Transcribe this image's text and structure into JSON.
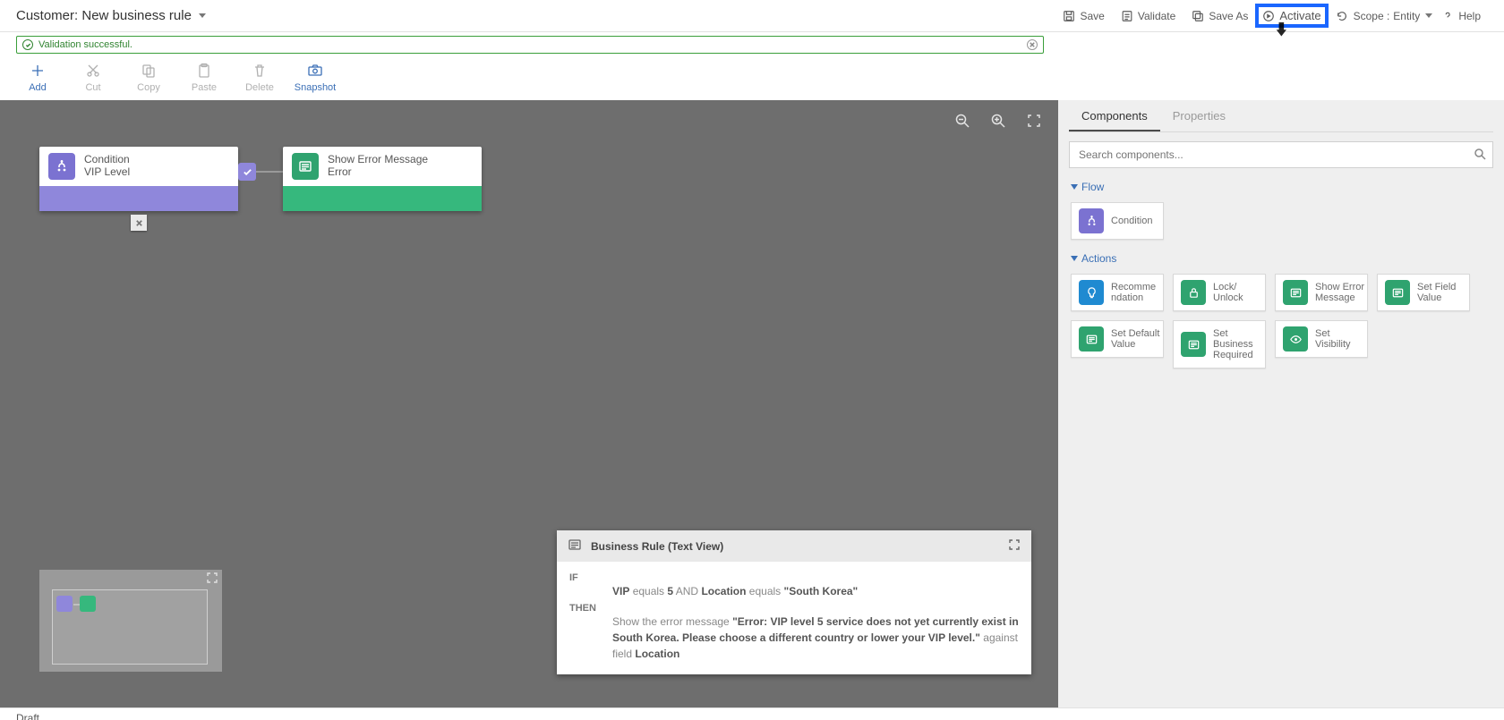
{
  "header": {
    "title_prefix": "Customer:",
    "title_name": "New business rule",
    "buttons": {
      "save": "Save",
      "validate": "Validate",
      "save_as": "Save As",
      "activate": "Activate",
      "scope_label": "Scope :",
      "scope_value": "Entity",
      "help": "Help"
    }
  },
  "banner": {
    "message": "Validation successful."
  },
  "toolbar": {
    "add": "Add",
    "cut": "Cut",
    "copy": "Copy",
    "paste": "Paste",
    "delete": "Delete",
    "snapshot": "Snapshot"
  },
  "canvas": {
    "condition": {
      "title": "Condition",
      "sub": "VIP Level"
    },
    "error": {
      "title": "Show Error Message",
      "sub": "Error"
    }
  },
  "textview": {
    "title": "Business Rule (Text View)",
    "kw_if": "IF",
    "kw_then": "THEN",
    "if_field1": "VIP",
    "if_op1": "equals",
    "if_val1": "5",
    "if_and": "AND",
    "if_field2": "Location",
    "if_op2": "equals",
    "if_val2": "\"South Korea\"",
    "then_pre": "Show the error message",
    "then_msg": "\"Error: VIP level 5 service does not yet currently exist in South Korea. Please choose a different country or lower your VIP level.\"",
    "then_post1": "against field",
    "then_field": "Location"
  },
  "panel": {
    "tabs": {
      "components": "Components",
      "properties": "Properties"
    },
    "search_placeholder": "Search components...",
    "sections": {
      "flow": "Flow",
      "actions": "Actions"
    },
    "flow_items": {
      "condition": "Condition"
    },
    "action_items": {
      "recommendation": "Recomme\nndation",
      "lock": "Lock/\nUnlock",
      "show_error": "Show Error\nMessage",
      "set_field": "Set Field\nValue",
      "set_default": "Set Default\nValue",
      "set_required": "Set\nBusiness\nRequired",
      "set_visibility": "Set\nVisibility"
    }
  },
  "footer": {
    "status": "Draft"
  }
}
